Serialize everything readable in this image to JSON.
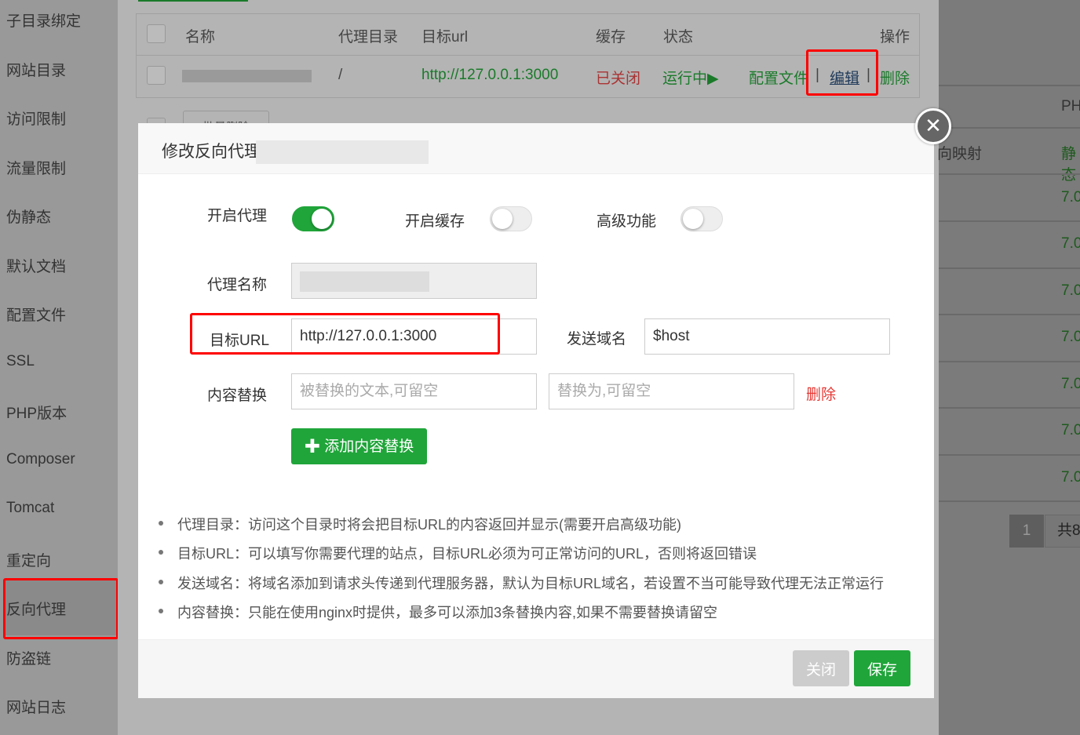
{
  "sidebar": {
    "items": [
      "子目录绑定",
      "网站目录",
      "访问限制",
      "流量限制",
      "伪静态",
      "默认文档",
      "配置文件",
      "SSL",
      "PHP版本",
      "Composer",
      "Tomcat",
      "重定向",
      "反向代理",
      "防盗链",
      "网站日志"
    ],
    "active": "反向代理"
  },
  "table": {
    "headers": [
      "名称",
      "代理目录",
      "目标url",
      "缓存",
      "状态",
      "操作"
    ],
    "row": {
      "dir": "/",
      "url": "http://127.0.0.1:3000",
      "cache": "已关闭",
      "status": "运行中▶",
      "actions": [
        "配置文件",
        "编辑",
        "删除"
      ],
      "separator": "|"
    },
    "batch_label": "批量删除"
  },
  "right": {
    "header": "PH",
    "row1_left": "向映射",
    "row1_right": "静态",
    "versions": [
      "7.0",
      "7.0",
      "7.0",
      "7.0",
      "7.0",
      "7.0",
      "7.0"
    ],
    "page": "1",
    "total": "共8"
  },
  "modal": {
    "title": "修改反向代理",
    "toggles": [
      {
        "label": "开启代理",
        "on": true
      },
      {
        "label": "开启缓存",
        "on": false
      },
      {
        "label": "高级功能",
        "on": false
      }
    ],
    "name_label": "代理名称",
    "url_label": "目标URL",
    "url_value": "http://127.0.0.1:3000",
    "host_label": "发送域名",
    "host_value": "$host",
    "replace_label": "内容替换",
    "replace_from_placeholder": "被替换的文本,可留空",
    "replace_to_placeholder": "替换为,可留空",
    "replace_delete": "删除",
    "add_replace": "添加内容替换",
    "tips": [
      "代理目录：访问这个目录时将会把目标URL的内容返回并显示(需要开启高级功能)",
      "目标URL：可以填写你需要代理的站点，目标URL必须为可正常访问的URL，否则将返回错误",
      "发送域名：将域名添加到请求头传递到代理服务器，默认为目标URL域名，若设置不当可能导致代理无法正常运行",
      "内容替换：只能在使用nginx时提供，最多可以添加3条替换内容,如果不需要替换请留空"
    ],
    "close_btn": "关闭",
    "save_btn": "保存"
  },
  "colors": {
    "accent": "#20a53a",
    "danger": "#e53935",
    "highlight": "#ff0000"
  }
}
